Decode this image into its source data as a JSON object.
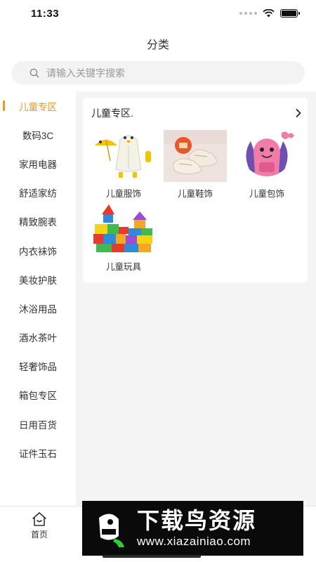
{
  "status_bar": {
    "time": "11:33"
  },
  "header": {
    "title": "分类"
  },
  "search": {
    "placeholder": "请输入关键字搜索"
  },
  "sidebar": {
    "active_index": 0,
    "items": [
      {
        "label": "儿童专区"
      },
      {
        "label": "数码3C"
      },
      {
        "label": "家用电器"
      },
      {
        "label": "舒适家纺"
      },
      {
        "label": "精致腕表"
      },
      {
        "label": "内衣袜饰"
      },
      {
        "label": "美妆护肤"
      },
      {
        "label": "沐浴用品"
      },
      {
        "label": "酒水茶叶"
      },
      {
        "label": "轻奢饰品"
      },
      {
        "label": "箱包专区"
      },
      {
        "label": "日用百货"
      },
      {
        "label": "证件玉石"
      }
    ]
  },
  "category_card": {
    "title": "儿童专区.",
    "subcategories": [
      {
        "label": "儿童服饰",
        "icon": "raincoat-image"
      },
      {
        "label": "儿童鞋饰",
        "icon": "kids-shoes-image"
      },
      {
        "label": "儿童包饰",
        "icon": "butterfly-backpack-image"
      },
      {
        "label": "儿童玩具",
        "icon": "building-blocks-image"
      }
    ]
  },
  "tab_bar": {
    "home_label": "首页"
  },
  "watermark": {
    "title": "下载鸟资源",
    "url": "www.xiazainiao.com"
  },
  "colors": {
    "accent": "#e09a2c",
    "content_bg": "#f4f4f4"
  }
}
